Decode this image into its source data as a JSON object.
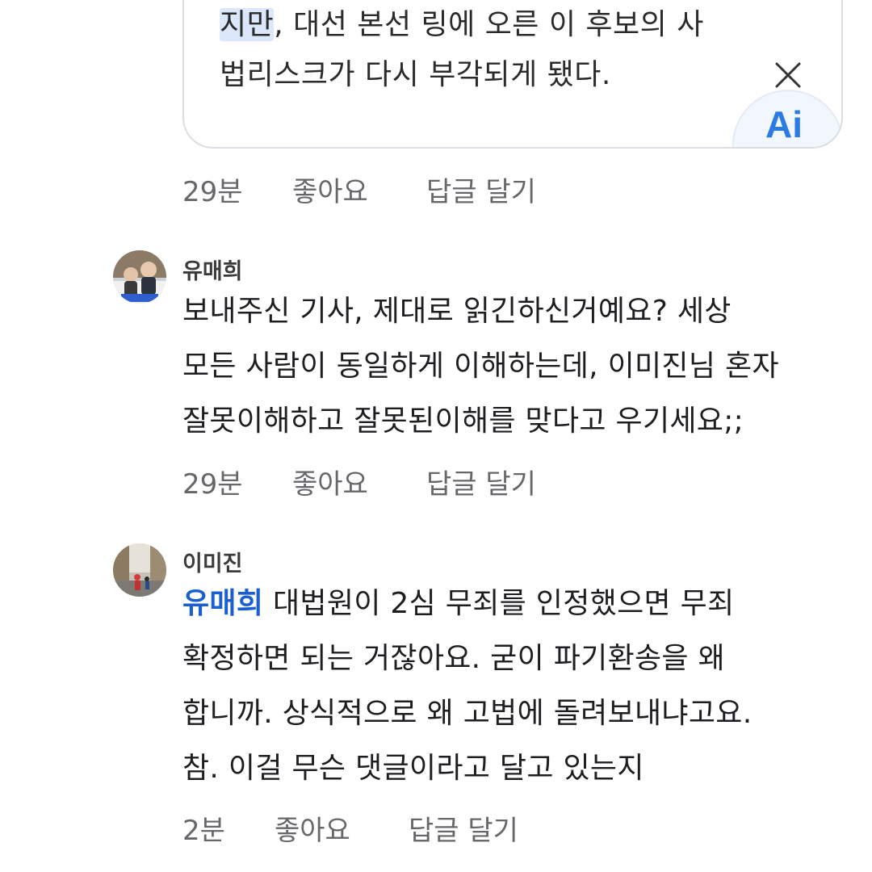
{
  "article": {
    "highlight": "지만",
    "line1_rest": ", 대선 본선 링에 오른 이 후보의 사",
    "line2": "법리스크가 다시 부각되게 됐다.",
    "ai_badge_text": "Ai",
    "colors": {
      "border": "#dadde1",
      "highlight": "#dbe8fb",
      "badge": "#2b7be4"
    }
  },
  "actions_labels": {
    "like": "좋아요",
    "reply": "답글 달기"
  },
  "comments": [
    {
      "time": "29분"
    },
    {
      "author": "유매희",
      "lines": [
        "보내주신 기사, 제대로 읽긴하신거예요? 세상",
        "모든 사람이 동일하게 이해하는데, 이미진님 혼자",
        "잘못이해하고 잘못된이해를 맞다고 우기세요;;"
      ],
      "time": "29분"
    },
    {
      "author": "이미진",
      "mention": "유매희",
      "line1_rest": " 대법원이 2심 무죄를 인정했으면 무죄",
      "lines": [
        "확정하면 되는 거잖아요. 굳이 파기환송을 왜",
        "합니까. 상식적으로 왜 고법에 돌려보내냐고요.",
        "참. 이걸 무슨 댓글이라고 달고 있는지"
      ],
      "time": "2분"
    }
  ],
  "colors": {
    "meta_text": "#65676b",
    "mention": "#1a5fd1",
    "author": "#3a3b3c"
  },
  "icons": [
    "close-icon",
    "ai-badge-icon",
    "avatar"
  ]
}
